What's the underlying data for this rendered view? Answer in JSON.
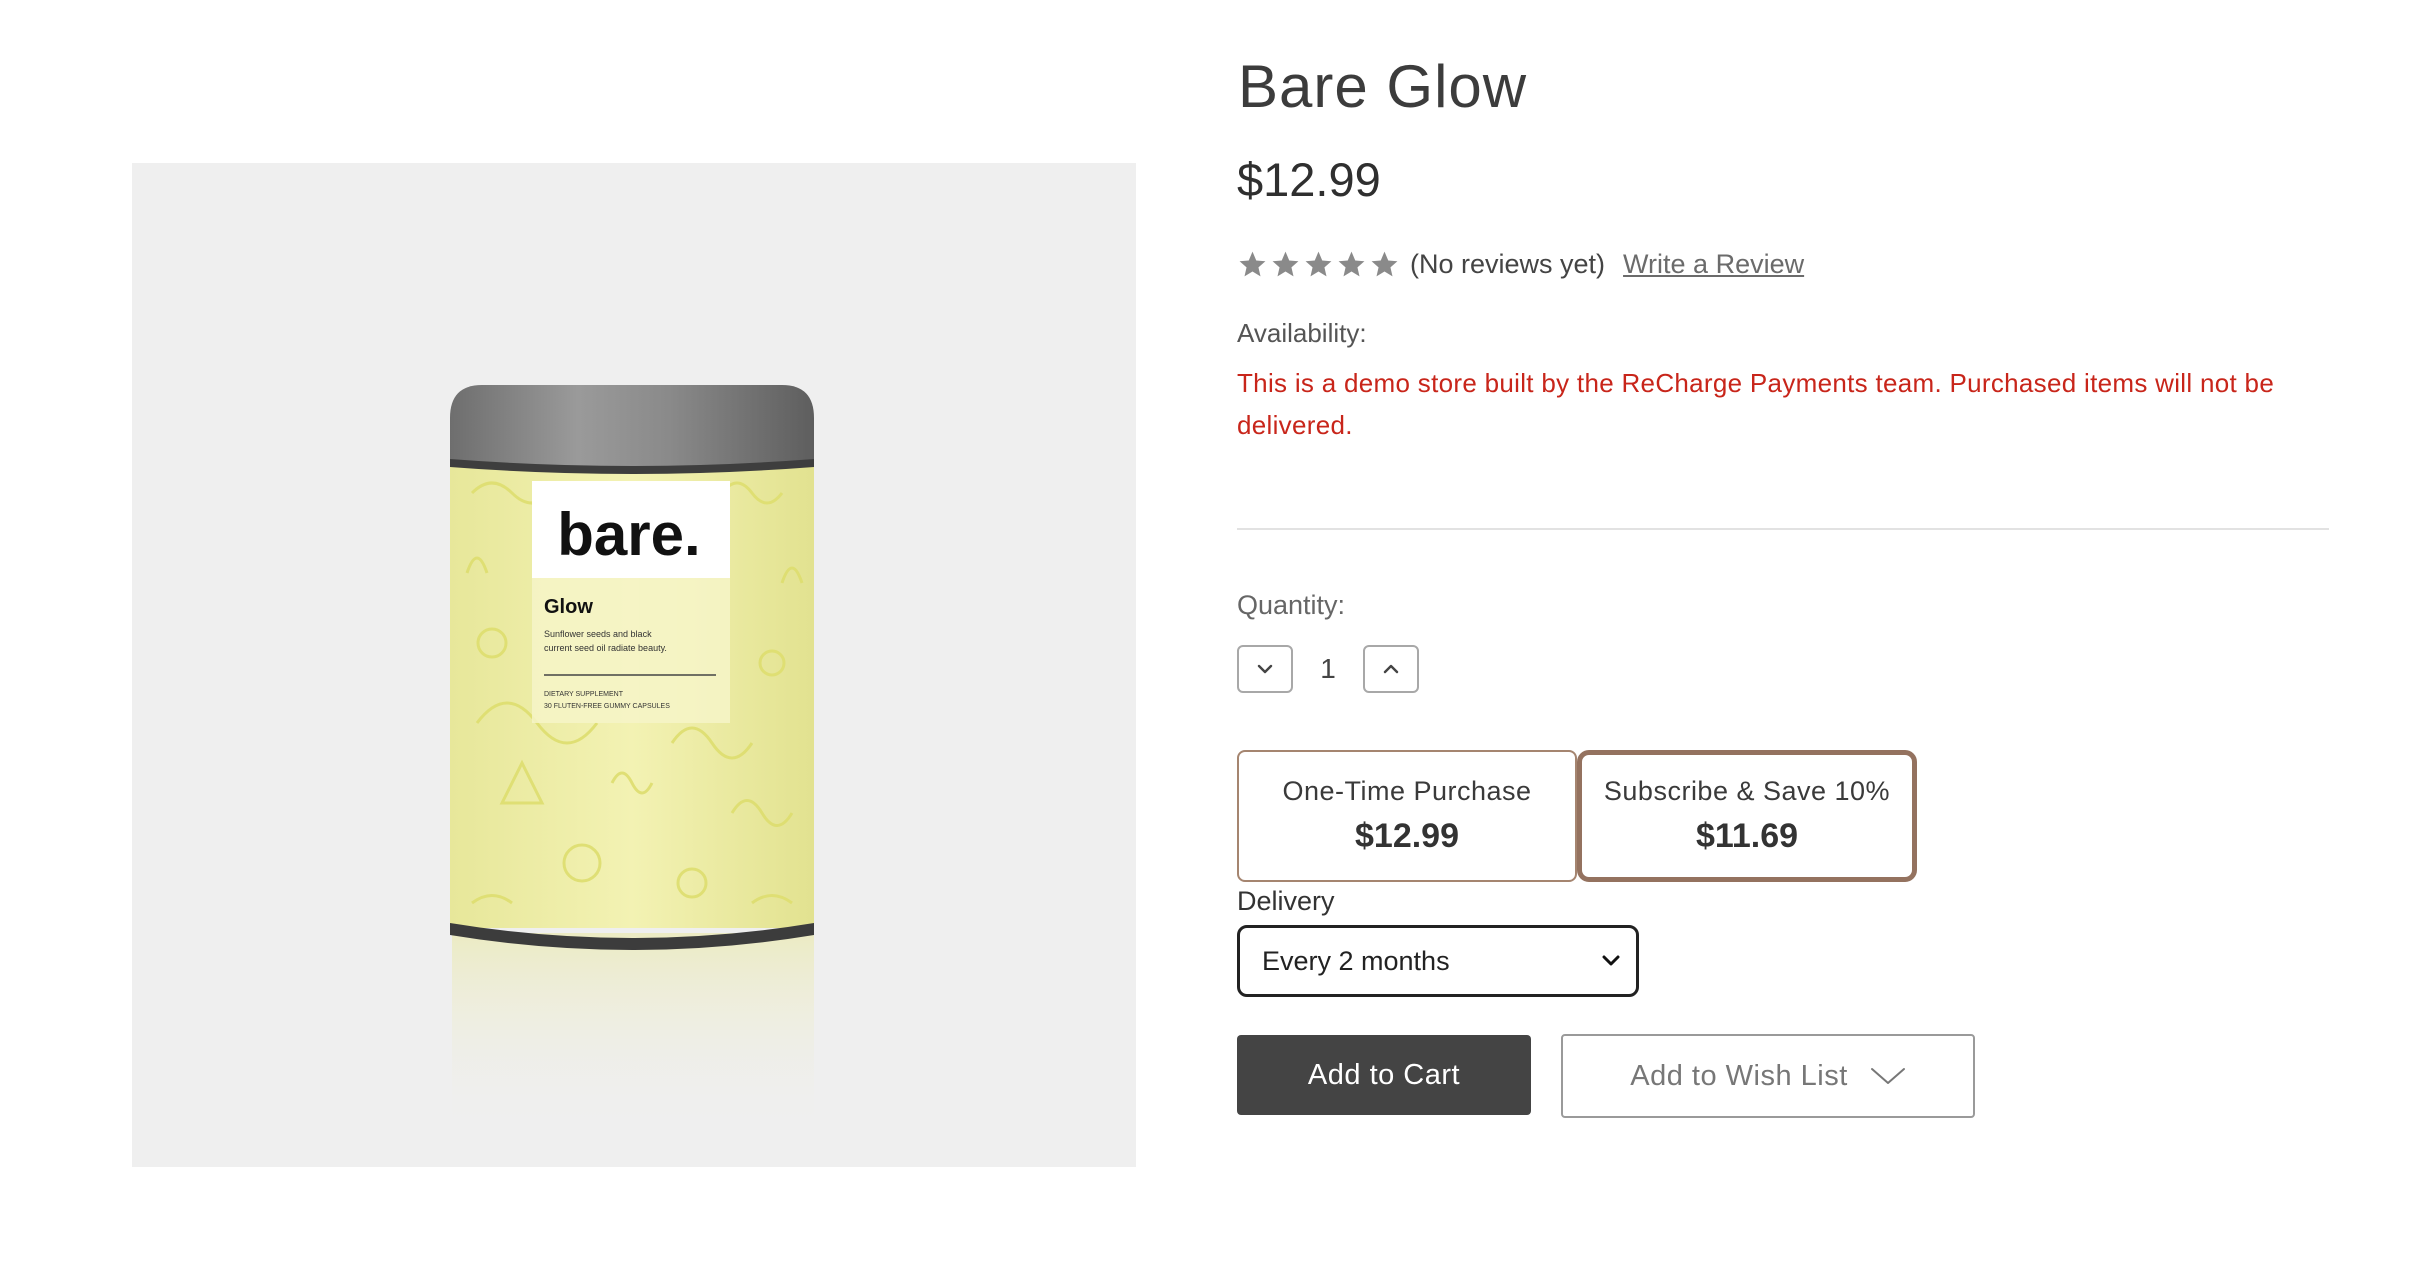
{
  "product": {
    "title": "Bare Glow",
    "price": "$12.99",
    "rating_stars": 5,
    "reviews_text": "(No reviews yet)",
    "write_review_label": "Write a Review",
    "availability_label": "Availability:",
    "availability_text": "This is a demo store built by the ReCharge Payments team. Purchased items will not be delivered.",
    "image": {
      "brand": "bare.",
      "name": "Glow",
      "description_line1": "Sunflower seeds and black",
      "description_line2": "current seed oil radiate beauty.",
      "supplement_line1": "DIETARY SUPPLEMENT",
      "supplement_line2": "30 FLUTEN-FREE GUMMY CAPSULES"
    }
  },
  "quantity": {
    "label": "Quantity:",
    "value": "1",
    "decrement_icon": "chevron-down-icon",
    "increment_icon": "chevron-up-icon"
  },
  "purchase_options": [
    {
      "label": "One-Time Purchase",
      "price": "$12.99",
      "selected": false
    },
    {
      "label": "Subscribe & Save 10%",
      "price": "$11.69",
      "selected": true
    }
  ],
  "delivery": {
    "label": "Delivery",
    "selected": "Every 2 months"
  },
  "actions": {
    "add_to_cart": "Add to Cart",
    "add_to_wishlist": "Add to Wish List"
  },
  "colors": {
    "availability": "#c8251a",
    "cart_button": "#444444",
    "selected_option_border": "#94725f",
    "star": "#8a8a8a",
    "image_background": "#efefef"
  }
}
